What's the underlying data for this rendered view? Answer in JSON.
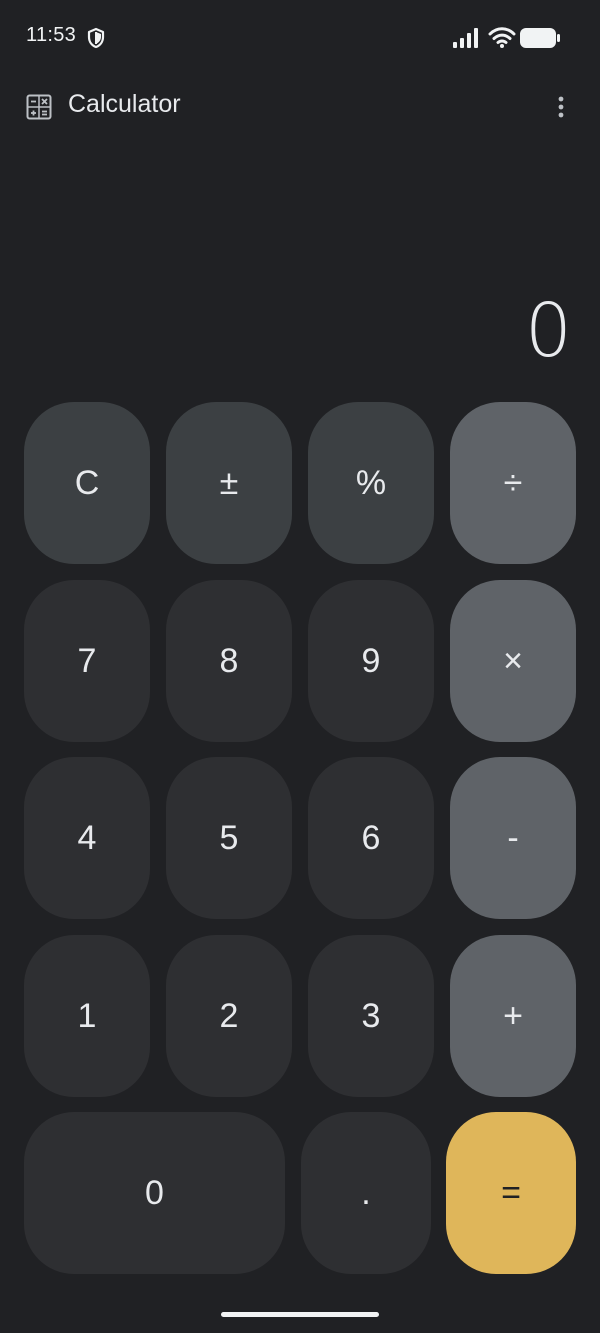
{
  "status_bar": {
    "time": "11:53"
  },
  "app_bar": {
    "title": "Calculator"
  },
  "display": {
    "value": "0"
  },
  "keypad": {
    "row1": [
      "C",
      "±",
      "%",
      "÷"
    ],
    "row2": [
      "7",
      "8",
      "9",
      "×"
    ],
    "row3": [
      "4",
      "5",
      "6",
      "-"
    ],
    "row4": [
      "1",
      "2",
      "3",
      "+"
    ],
    "row5": [
      "0",
      ".",
      "="
    ]
  },
  "colors": {
    "background": "#202124",
    "function_key": "#3c4043",
    "number_key": "#2e2f32",
    "operator_key": "#5f6368",
    "equals_key": "#dfb65a"
  }
}
